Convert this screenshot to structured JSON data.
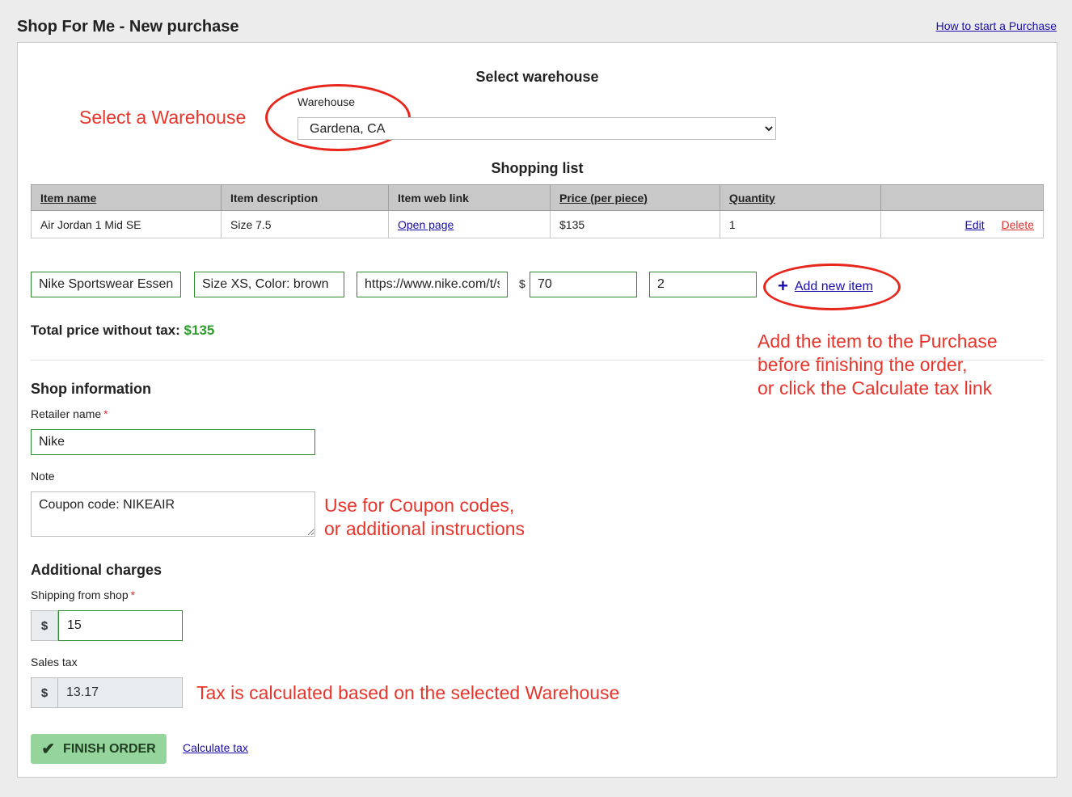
{
  "page": {
    "title": "Shop For Me - New purchase",
    "help_link": "How to start a Purchase"
  },
  "warehouse": {
    "heading": "Select warehouse",
    "label": "Warehouse",
    "selected": "Gardena, CA"
  },
  "shopping_list": {
    "heading": "Shopping list",
    "columns": [
      "Item name",
      "Item description",
      "Item web link",
      "Price (per piece)",
      "Quantity",
      ""
    ],
    "rows": [
      {
        "name": "Air Jordan 1 Mid SE",
        "description": "Size 7.5",
        "link_text": "Open page",
        "price": "$135",
        "quantity": "1",
        "edit": "Edit",
        "delete": "Delete"
      }
    ]
  },
  "new_item": {
    "name": "Nike Sportswear Essential",
    "description": "Size XS, Color: brown",
    "link": "https://www.nike.com/t/sportswear",
    "currency": "$",
    "price": "70",
    "quantity": "2",
    "add_label": "Add new item"
  },
  "total": {
    "label": "Total price without tax:",
    "value": "$135"
  },
  "shop_info": {
    "heading": "Shop information",
    "retailer_label": "Retailer name",
    "required_mark": "*",
    "retailer_value": "Nike",
    "note_label": "Note",
    "note_value": "Coupon code: NIKEAIR"
  },
  "charges": {
    "heading": "Additional charges",
    "shipping_label": "Shipping from shop",
    "shipping_value": "15",
    "currency": "$",
    "tax_label": "Sales tax",
    "tax_value": "13.17"
  },
  "actions": {
    "finish": "FINISH ORDER",
    "calculate": "Calculate tax"
  },
  "annotations": {
    "select_warehouse": "Select a Warehouse",
    "add_item_line1": "Add the item to the Purchase",
    "add_item_line2": "before finishing the order,",
    "add_item_line3": "or click the Calculate tax link",
    "coupon_line1": "Use for Coupon codes,",
    "coupon_line2": "or additional instructions",
    "tax_note": "Tax is calculated based on the selected Warehouse"
  },
  "colors": {
    "annotation_red": "#e8352c",
    "accent_green": "#2e9b2e",
    "finish_button": "#95d49a",
    "link_blue": "#1a0dab"
  }
}
